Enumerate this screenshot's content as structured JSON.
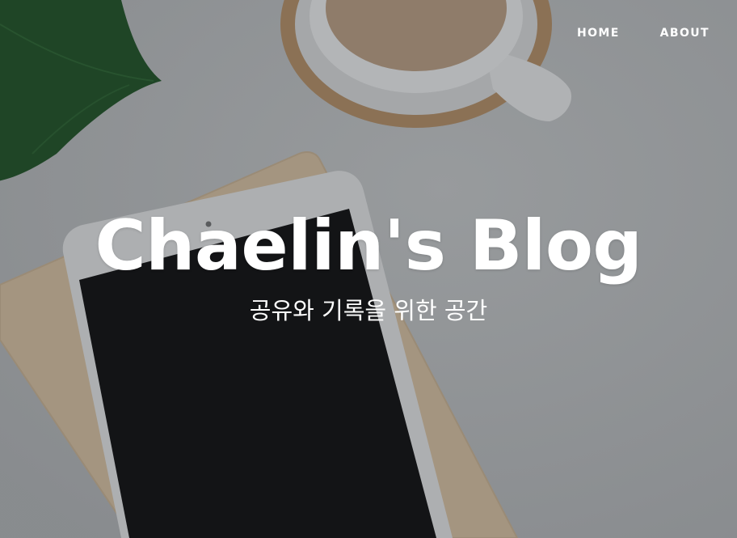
{
  "nav": {
    "items": [
      {
        "label": "HOME"
      },
      {
        "label": "ABOUT"
      }
    ]
  },
  "hero": {
    "title": "Chaelin's Blog",
    "subtitle": "공유와 기록을 위한 공간",
    "background": {
      "description_icon": "desk-flatlay-image",
      "colors": {
        "desk": "#8e9194",
        "tablet_screen": "#131416",
        "tablet_frame": "#aeb0b2",
        "wood": "#a49480",
        "cork": "#8a6f51",
        "leaf": "#224a2a"
      }
    }
  }
}
